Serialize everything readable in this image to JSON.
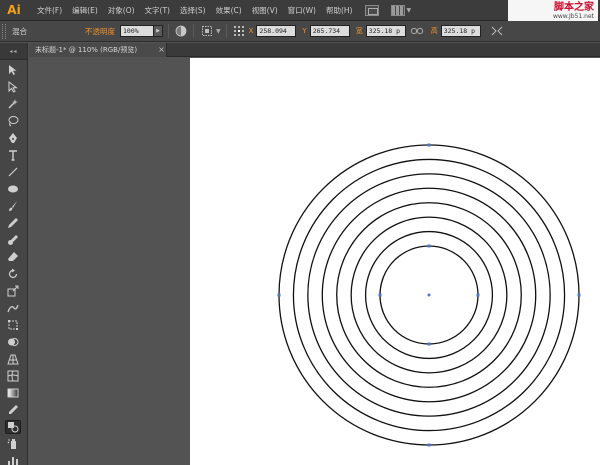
{
  "app": {
    "logo": "Ai"
  },
  "menu": {
    "items": [
      "文件(F)",
      "编辑(E)",
      "对象(O)",
      "文字(T)",
      "选择(S)",
      "效果(C)",
      "视图(V)",
      "窗口(W)",
      "帮助(H)"
    ]
  },
  "watermark": {
    "title": "脚本之家",
    "url": "www.Jb51.net"
  },
  "control_bar": {
    "selection_label": "混合",
    "opacity_label": "不透明度",
    "opacity_value": "100%",
    "x_label": "X",
    "x_value": "258.094",
    "y_label": "Y",
    "y_value": "265.734",
    "w_label": "宽",
    "w_value": "325.18 p",
    "h_label": "高",
    "h_value": "325.18 p"
  },
  "document": {
    "tab_title": "未标题-1* @ 110% (RGB/预览)",
    "tab_close": "×"
  },
  "artwork": {
    "type": "blend of concentric circles",
    "circle_count": 8,
    "stroke_color": "#111111",
    "anchor_color": "#4a78c8"
  },
  "icons": {
    "toolbox": [
      "selection-tool",
      "direct-selection-tool",
      "magic-wand-tool",
      "lasso-tool",
      "pen-tool",
      "type-tool",
      "line-tool",
      "ellipse-tool",
      "paintbrush-tool",
      "pencil-tool",
      "blob-brush-tool",
      "eraser-tool",
      "rotate-tool",
      "scale-tool",
      "warp-tool",
      "free-transform-tool",
      "shape-builder-tool",
      "perspective-grid-tool",
      "mesh-tool",
      "gradient-tool",
      "eyedropper-tool",
      "blend-tool",
      "symbol-sprayer-tool",
      "column-graph-tool",
      "artboard-tool"
    ]
  }
}
